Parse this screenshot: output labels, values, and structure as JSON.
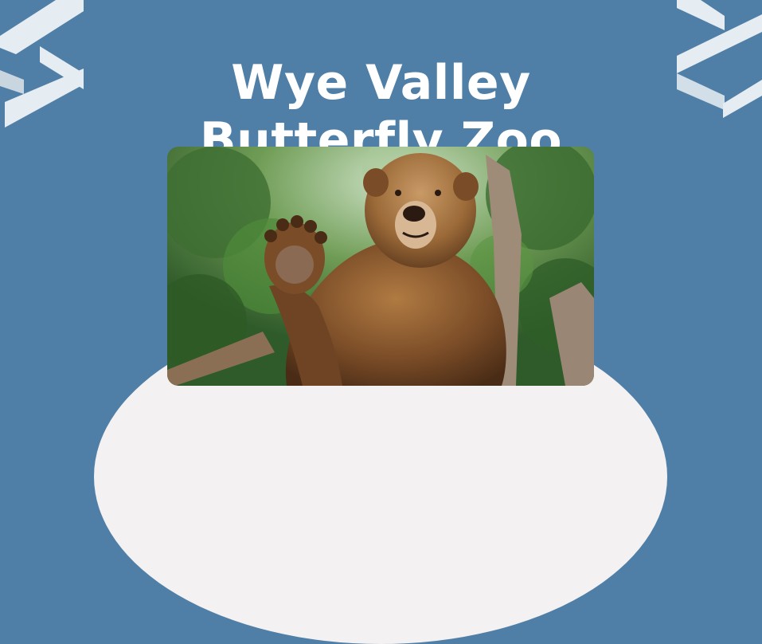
{
  "title": {
    "line1": "Wye Valley",
    "line2": "Butterfly Zoo"
  },
  "colors": {
    "background": "#4f7fa7",
    "dome": "#f3f1f2",
    "title_text": "#ffffff",
    "deco_stripes": "#e6edf2"
  },
  "icons": {
    "left_decoration": "zigzag-arrow-icon",
    "right_decoration": "zigzag-arrow-icon"
  },
  "photo": {
    "subject": "brown-bear-waving"
  }
}
